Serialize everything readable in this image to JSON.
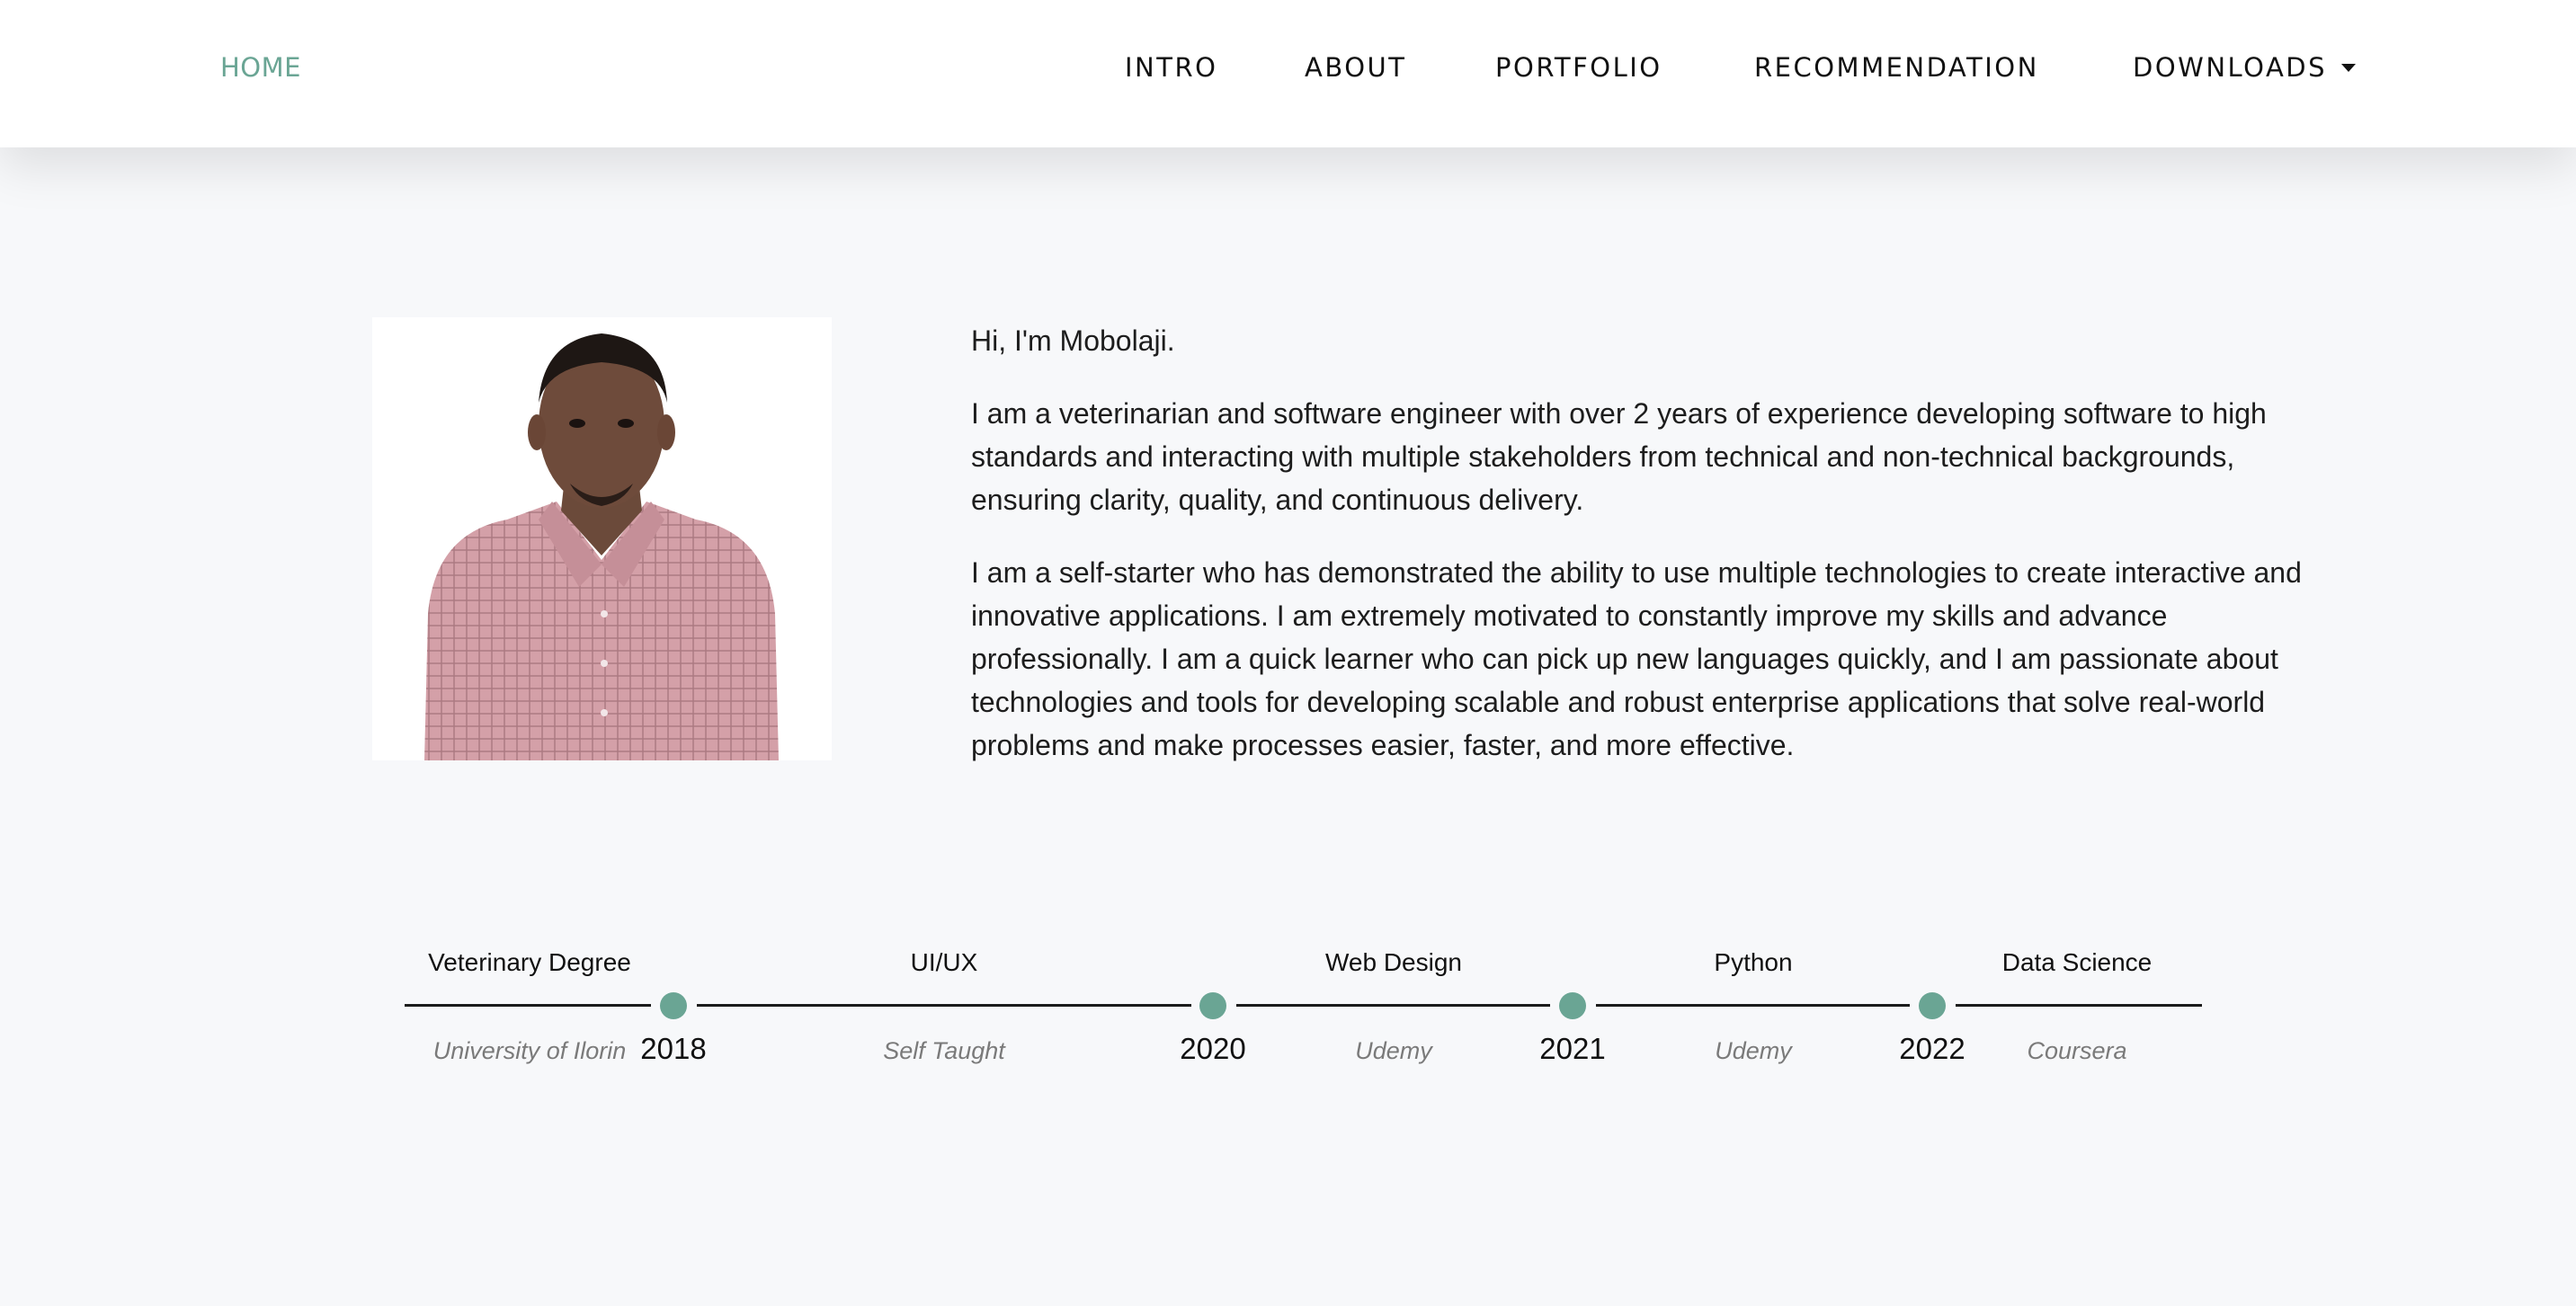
{
  "nav": {
    "brand": "HOME",
    "items": [
      {
        "label": "INTRO"
      },
      {
        "label": "ABOUT"
      },
      {
        "label": "PORTFOLIO"
      },
      {
        "label": "RECOMMENDATION"
      },
      {
        "label": "DOWNLOADS"
      }
    ]
  },
  "intro": {
    "greeting": "Hi, I'm Mobolaji.",
    "paragraph1": "I am a veterinarian and software engineer with over 2 years of experience developing software to high standards and interacting with multiple stakeholders from technical and non-technical backgrounds, ensuring clarity, quality, and continuous delivery.",
    "paragraph2": "I am a self-starter who has demonstrated the ability to use multiple technologies to create interactive and innovative applications. I am extremely motivated to constantly improve my skills and advance professionally. I am a quick learner who can pick up new languages quickly, and I am passionate about technologies and tools for developing scalable and robust enterprise applications that solve real-world problems and make processes easier, faster, and more effective."
  },
  "timeline": {
    "entries": [
      {
        "title": "Veterinary Degree",
        "subtitle": "University of Ilorin"
      },
      {
        "title": "UI/UX",
        "subtitle": "Self Taught"
      },
      {
        "title": "Web Design",
        "subtitle": "Udemy"
      },
      {
        "title": "Python",
        "subtitle": "Udemy"
      },
      {
        "title": "Data Science",
        "subtitle": "Coursera"
      }
    ],
    "years": [
      "2018",
      "2020",
      "2021",
      "2022"
    ]
  },
  "colors": {
    "accent": "#6aa594",
    "background": "#f7f8fa",
    "navbar": "#ffffff"
  }
}
